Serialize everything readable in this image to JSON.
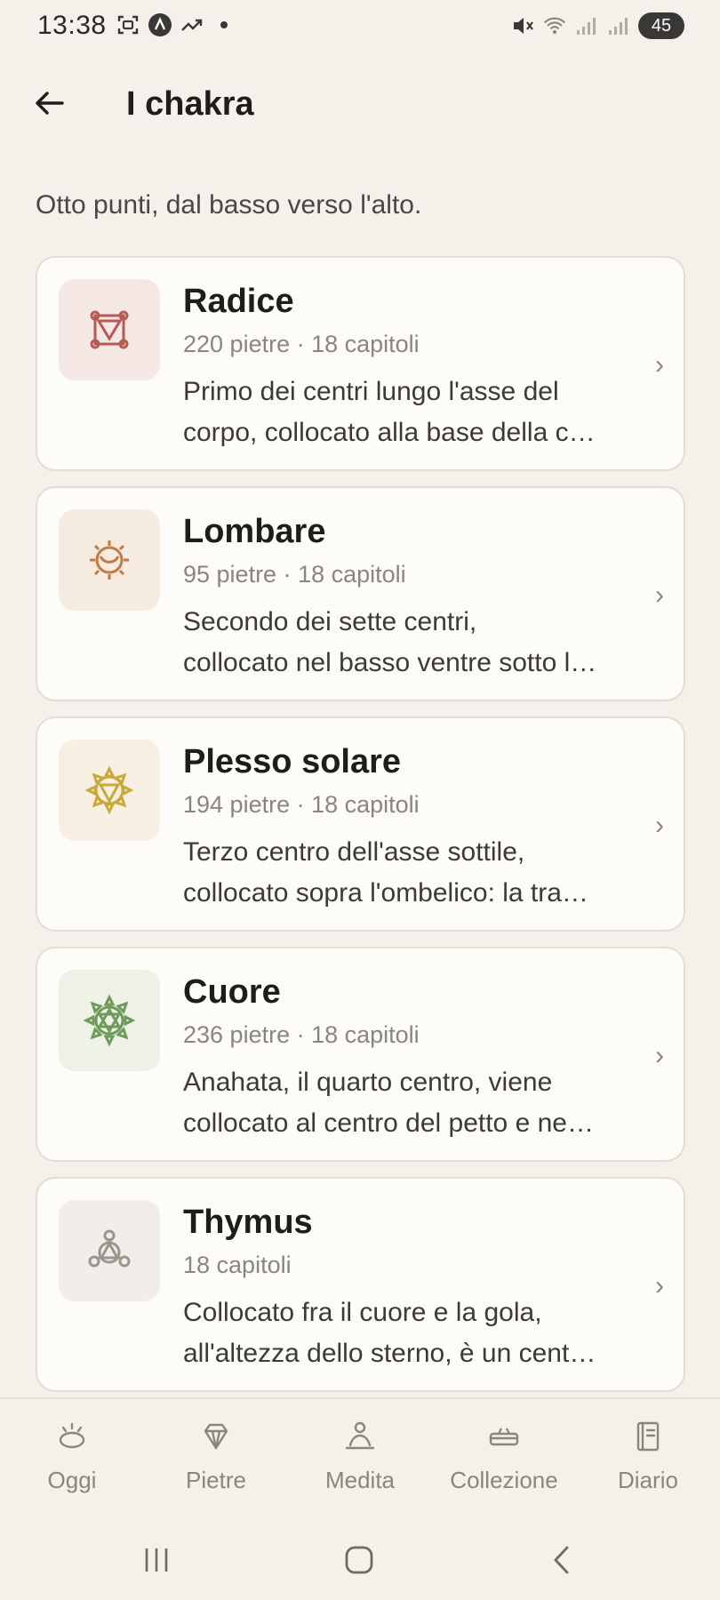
{
  "status_bar": {
    "time": "13:38",
    "battery": "45",
    "left_icons": [
      "screenshot-icon",
      "app-icon",
      "trending-icon",
      "dot-icon"
    ],
    "right_icons": [
      "mute-icon",
      "wifi-icon",
      "signal-icon",
      "signal-icon"
    ]
  },
  "header": {
    "back_icon": "arrow-left-icon",
    "title": "I chakra"
  },
  "subtitle": "Otto punti, dal basso verso l'alto.",
  "chakras": [
    {
      "title": "Radice",
      "meta": "220 pietre · 18 capitoli",
      "desc_line1": "Primo dei centri lungo l'asse del",
      "desc_line2": "corpo, collocato alla base della c…",
      "icon": "root-chakra-icon",
      "color": "#b85a54",
      "bg": "#f5e8e4"
    },
    {
      "title": "Lombare",
      "meta": "95 pietre · 18 capitoli",
      "desc_line1": "Secondo dei sette centri,",
      "desc_line2": "collocato nel basso ventre sotto l…",
      "icon": "sacral-chakra-icon",
      "color": "#c17a44",
      "bg": "#f6ebe1"
    },
    {
      "title": "Plesso solare",
      "meta": "194 pietre · 18 capitoli",
      "desc_line1": "Terzo centro dell'asse sottile,",
      "desc_line2": "collocato sopra l'ombelico: la tra…",
      "icon": "solar-plexus-chakra-icon",
      "color": "#c9a83c",
      "bg": "#f6efe2"
    },
    {
      "title": "Cuore",
      "meta": "236 pietre · 18 capitoli",
      "desc_line1": "Anahata, il quarto centro, viene",
      "desc_line2": "collocato al centro del petto e ne…",
      "icon": "heart-chakra-icon",
      "color": "#6e9a5a",
      "bg": "#eef1e6"
    },
    {
      "title": "Thymus",
      "meta": "18 capitoli",
      "desc_line1": "Collocato fra il cuore e la gola,",
      "desc_line2": "all'altezza dello sterno, è un cent…",
      "icon": "thymus-chakra-icon",
      "color": "#9a958d",
      "bg": "#f1eee9"
    }
  ],
  "chevron": "›",
  "bottom_nav": [
    {
      "label": "Oggi",
      "icon": "sun-rise-icon"
    },
    {
      "label": "Pietre",
      "icon": "gem-icon"
    },
    {
      "label": "Medita",
      "icon": "meditation-icon"
    },
    {
      "label": "Collezione",
      "icon": "collection-icon"
    },
    {
      "label": "Diario",
      "icon": "journal-icon"
    }
  ],
  "system_nav": [
    "recent-apps-icon",
    "home-icon",
    "back-icon"
  ]
}
